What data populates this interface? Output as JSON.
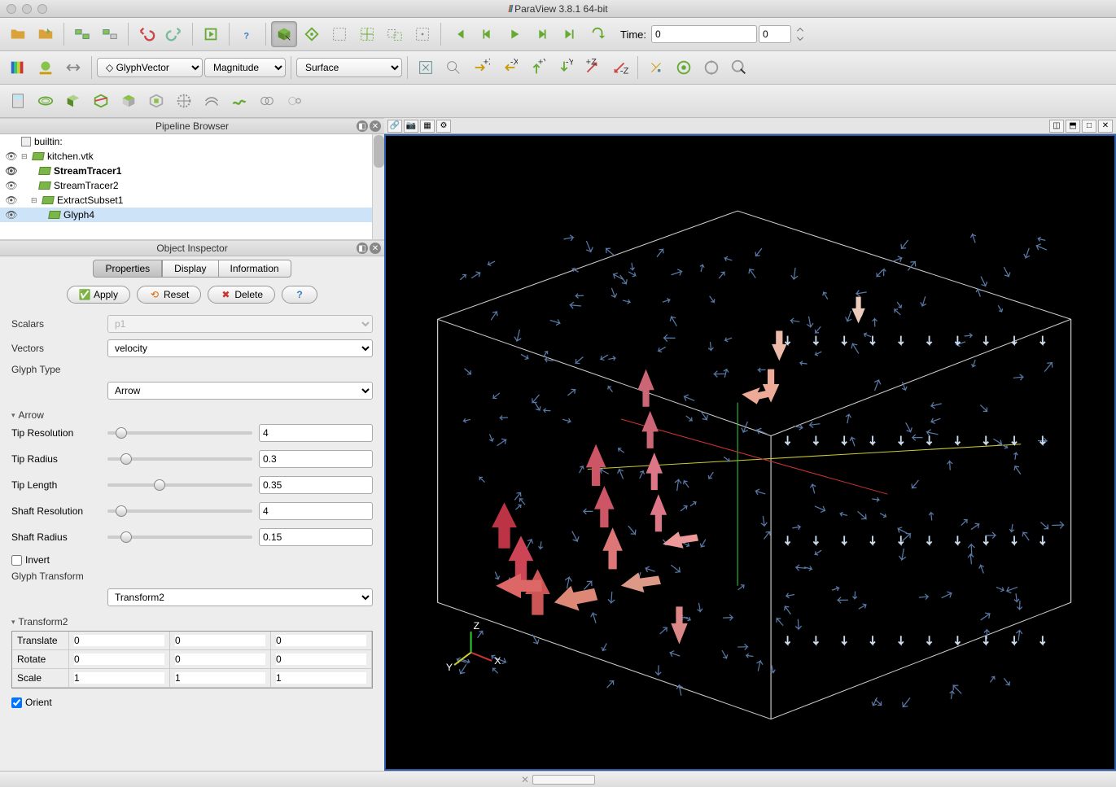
{
  "window": {
    "title": "ParaView 3.8.1 64-bit"
  },
  "toolbar": {
    "coloring_field": "GlyphVector",
    "coloring_mode": "Magnitude",
    "representation": "Surface",
    "time_label": "Time:",
    "time_value": "0",
    "time_index": "0"
  },
  "pipeline": {
    "title": "Pipeline Browser",
    "root": "builtin:",
    "items": [
      {
        "label": "kitchen.vtk",
        "indent": 0,
        "bold": false
      },
      {
        "label": "StreamTracer1",
        "indent": 1,
        "bold": true
      },
      {
        "label": "StreamTracer2",
        "indent": 1,
        "bold": false
      },
      {
        "label": "ExtractSubset1",
        "indent": 1,
        "bold": false
      },
      {
        "label": "Glyph4",
        "indent": 2,
        "bold": false,
        "selected": true
      }
    ]
  },
  "inspector": {
    "title": "Object Inspector",
    "tabs": {
      "properties": "Properties",
      "display": "Display",
      "information": "Information"
    },
    "buttons": {
      "apply": "Apply",
      "reset": "Reset",
      "delete": "Delete"
    },
    "scalars_label": "Scalars",
    "scalars_value": "p1",
    "vectors_label": "Vectors",
    "vectors_value": "velocity",
    "glyph_type_label": "Glyph Type",
    "glyph_type_value": "Arrow",
    "arrow_section": "Arrow",
    "tip_resolution_label": "Tip Resolution",
    "tip_resolution_value": "4",
    "tip_radius_label": "Tip Radius",
    "tip_radius_value": "0.3",
    "tip_length_label": "Tip Length",
    "tip_length_value": "0.35",
    "shaft_resolution_label": "Shaft Resolution",
    "shaft_resolution_value": "4",
    "shaft_radius_label": "Shaft Radius",
    "shaft_radius_value": "0.15",
    "invert_label": "Invert",
    "glyph_transform_label": "Glyph Transform",
    "glyph_transform_value": "Transform2",
    "transform2_section": "Transform2",
    "translate_label": "Translate",
    "translate": [
      "0",
      "0",
      "0"
    ],
    "rotate_label": "Rotate",
    "rotate": [
      "0",
      "0",
      "0"
    ],
    "scale_label": "Scale",
    "scale": [
      "1",
      "1",
      "1"
    ],
    "orient_label": "Orient"
  },
  "render": {
    "axis_x": "X",
    "axis_y": "Y",
    "axis_z": "Z"
  }
}
